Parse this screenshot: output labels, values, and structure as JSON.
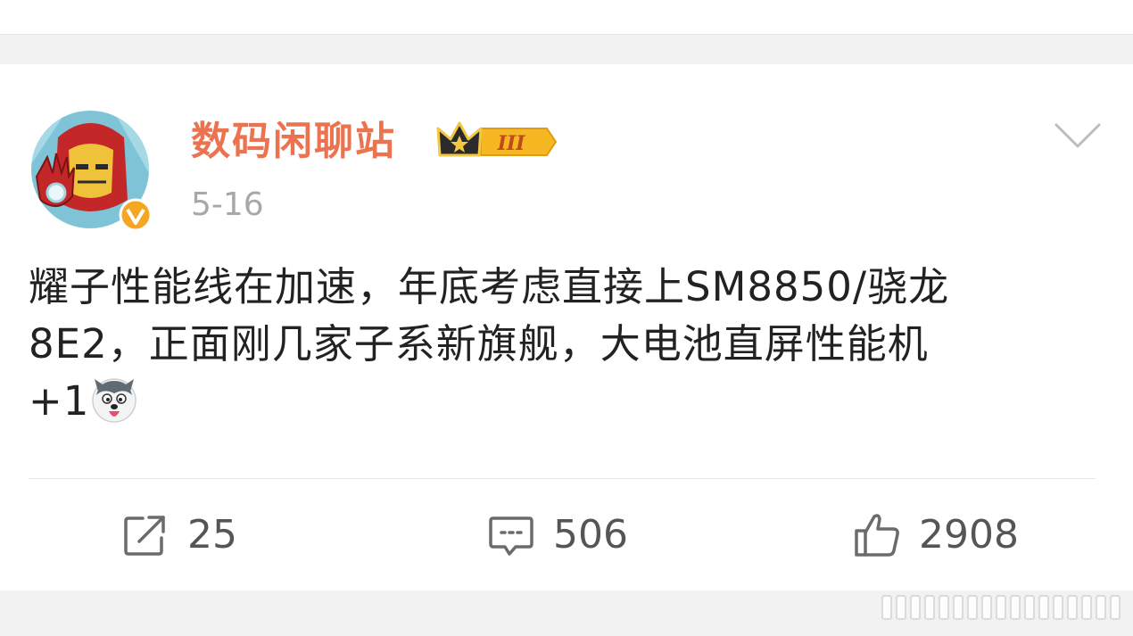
{
  "post": {
    "username": "数码闲聊站",
    "level_badge": "III",
    "date": "5-16",
    "content_lines": [
      "耀子性能线在加速，年底考虑直接上SM8850/骁龙",
      "8E2，正面刚几家子系新旗舰，大电池直屏性能机",
      "+1"
    ],
    "emoji": "husky-doge-emoji"
  },
  "actions": {
    "repost_count": "25",
    "comment_count": "506",
    "like_count": "2908"
  },
  "icons": {
    "menu": "chevron-down-icon",
    "repost": "repost-icon",
    "comment": "comment-icon",
    "like": "thumbs-up-icon",
    "verified": "verified-v-icon",
    "crown": "crown-icon"
  },
  "colors": {
    "username": "#eb7350",
    "text": "#222222",
    "meta": "#a8a8a8",
    "badge_gold": "#f5b823",
    "background": "#f2f2f2"
  }
}
